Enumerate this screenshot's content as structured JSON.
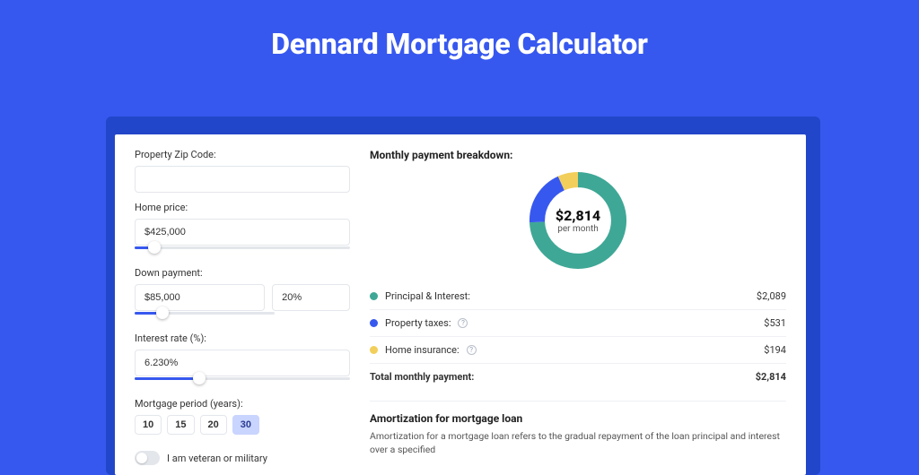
{
  "colors": {
    "accent": "#3758ef",
    "principal": "#3fa796",
    "taxes": "#3758ef",
    "insurance": "#f2cf5b"
  },
  "page": {
    "title": "Dennard Mortgage Calculator"
  },
  "form": {
    "zip": {
      "label": "Property Zip Code:",
      "value": ""
    },
    "home_price": {
      "label": "Home price:",
      "value": "$425,000",
      "slider_pct": 9
    },
    "down_payment": {
      "label": "Down payment:",
      "amount": "$85,000",
      "percent": "20%",
      "slider_pct": 20
    },
    "interest_rate": {
      "label": "Interest rate (%):",
      "value": "6.230%",
      "slider_pct": 30
    },
    "period": {
      "label": "Mortgage period (years):",
      "options": [
        "10",
        "15",
        "20",
        "30"
      ],
      "selected": "30"
    },
    "veteran": {
      "label": "I am veteran or military",
      "checked": false
    }
  },
  "summary": {
    "title": "Monthly payment breakdown:",
    "donut": {
      "amount": "$2,814",
      "sub": "per month"
    },
    "items": [
      {
        "label": "Principal & Interest:",
        "amount": "$2,089",
        "key": "principal",
        "info": false
      },
      {
        "label": "Property taxes:",
        "amount": "$531",
        "key": "taxes",
        "info": true
      },
      {
        "label": "Home insurance:",
        "amount": "$194",
        "key": "insurance",
        "info": true
      }
    ],
    "total": {
      "label": "Total monthly payment:",
      "amount": "$2,814"
    }
  },
  "amortization": {
    "title": "Amortization for mortgage loan",
    "text": "Amortization for a mortgage loan refers to the gradual repayment of the loan principal and interest over a specified"
  },
  "chart_data": {
    "type": "pie",
    "title": "Monthly payment breakdown",
    "series": [
      {
        "name": "Principal & Interest",
        "value": 2089,
        "color": "#3fa796"
      },
      {
        "name": "Property taxes",
        "value": 531,
        "color": "#3758ef"
      },
      {
        "name": "Home insurance",
        "value": 194,
        "color": "#f2cf5b"
      }
    ],
    "total": 2814,
    "center_label": "$2,814 per month"
  }
}
